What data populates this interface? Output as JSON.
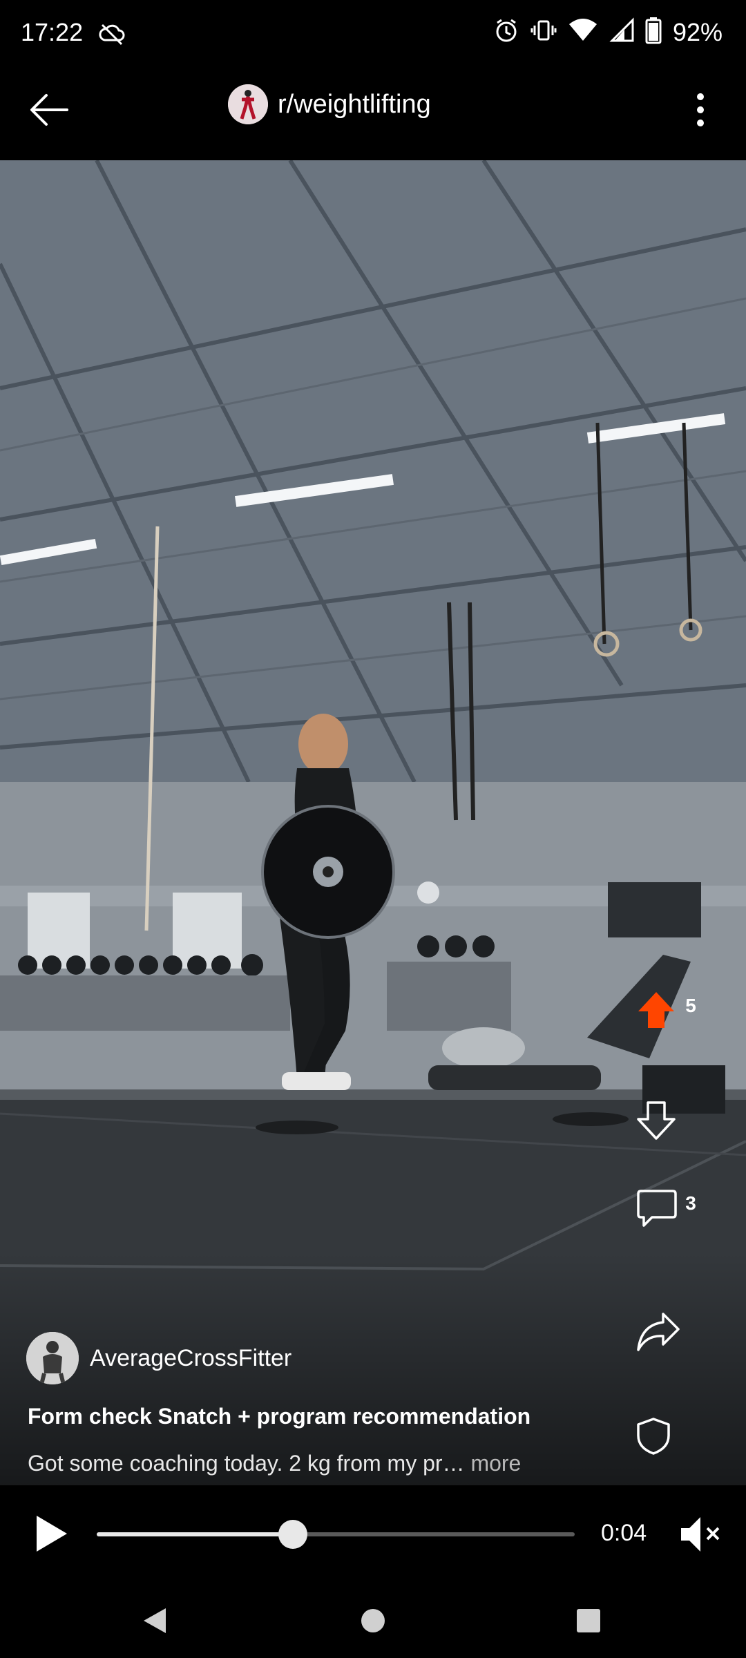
{
  "status_bar": {
    "time": "17:22",
    "battery_percent": "92%",
    "icons": [
      "cloud-off-icon",
      "alarm-icon",
      "vibrate-icon",
      "wifi-icon",
      "signal-icon",
      "battery-icon"
    ]
  },
  "header": {
    "subreddit": "r/weightlifting",
    "icons": [
      "back-arrow-icon",
      "subreddit-avatar",
      "more-vertical-icon"
    ]
  },
  "post": {
    "author": "AverageCrossFitter",
    "title": "Form check Snatch + program recommendation",
    "body_preview": "Got some coaching today. 2 kg from my pr…",
    "more_label": "more"
  },
  "actions": {
    "upvotes": "5",
    "comments": "3",
    "icons": [
      "upvote-icon",
      "downvote-icon",
      "comment-icon",
      "share-icon",
      "shield-icon"
    ],
    "upvote_color": "#ff4500"
  },
  "player": {
    "current_time": "0:04",
    "progress": 0.41,
    "icons": [
      "play-icon",
      "mute-icon"
    ]
  },
  "nav": {
    "icons": [
      "nav-back-icon",
      "nav-home-icon",
      "nav-recents-icon"
    ]
  }
}
